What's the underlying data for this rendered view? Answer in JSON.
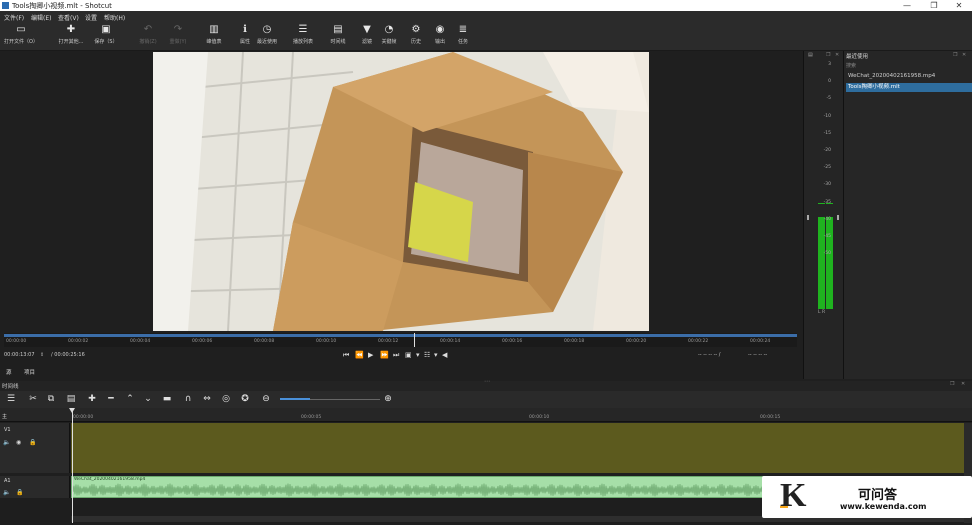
{
  "window": {
    "title": "Tools掏卿小视频.mlt - Shotcut",
    "controls": [
      "—",
      "❐",
      "✕"
    ]
  },
  "menu": [
    "文件(F)",
    "编辑(E)",
    "查看(V)",
    "设置",
    "帮助(H)"
  ],
  "toolbar": [
    {
      "label": "打开文件（O）",
      "icon": "open-file-icon",
      "glyph": "▭",
      "enabled": true
    },
    {
      "label": "打开其他...",
      "icon": "open-other-icon",
      "glyph": "✚",
      "enabled": true
    },
    {
      "label": "保存（S）",
      "icon": "save-icon",
      "glyph": "▣",
      "enabled": true
    },
    {
      "label": "撤销(Z)",
      "icon": "undo-icon",
      "glyph": "↶",
      "enabled": false
    },
    {
      "label": "重做(Y)",
      "icon": "redo-icon",
      "glyph": "↷",
      "enabled": false
    },
    {
      "label": "峰值表",
      "icon": "peak-meter-icon",
      "glyph": "▥",
      "enabled": true
    },
    {
      "label": "属性",
      "icon": "properties-icon",
      "glyph": "ℹ",
      "enabled": true
    },
    {
      "label": "最近使用",
      "icon": "recent-icon",
      "glyph": "◷",
      "enabled": true
    },
    {
      "label": "播放列表",
      "icon": "playlist-icon",
      "glyph": "☰",
      "enabled": true
    },
    {
      "label": "时间线",
      "icon": "timeline-icon",
      "glyph": "▤",
      "enabled": true
    },
    {
      "label": "滤镜",
      "icon": "filter-icon",
      "glyph": "▼",
      "enabled": true
    },
    {
      "label": "关键帧",
      "icon": "keyframe-icon",
      "glyph": "◔",
      "enabled": true
    },
    {
      "label": "历史",
      "icon": "history-icon",
      "glyph": "⚙",
      "enabled": true
    },
    {
      "label": "输出",
      "icon": "export-icon",
      "glyph": "◉",
      "enabled": true
    },
    {
      "label": "任务",
      "icon": "jobs-icon",
      "glyph": "≣",
      "enabled": true
    }
  ],
  "player": {
    "ruler_labels": [
      "00:00:00",
      "00:00:02",
      "00:00:04",
      "00:00:06",
      "00:00:08",
      "00:00:10",
      "00:00:12",
      "00:00:14",
      "00:00:16",
      "00:00:18",
      "00:00:20",
      "00:00:22",
      "00:00:24"
    ],
    "position": "00:00:13:07",
    "duration": "/ 00:00:25:16",
    "in_point": "-- -- -- -- /",
    "out_point": "-- -- -- --",
    "tabs": [
      "源",
      "项目"
    ]
  },
  "meter": {
    "labels": [
      "3",
      "0",
      "-5",
      "-10",
      "-15",
      "-20",
      "-25",
      "-30",
      "-35",
      "-40",
      "-45",
      "-50"
    ],
    "channels": "L  R",
    "level_db": -24
  },
  "recent": {
    "header": "最近使用",
    "search_placeholder": "搜索",
    "items": [
      "WeChat_20200402161958.mp4",
      "Tools掏卿小视频.mlt"
    ],
    "selected_index": 1
  },
  "timeline": {
    "title": "时间线",
    "ruler_labels": [
      "00:00:00",
      "00:00:05",
      "00:00:10",
      "00:00:15"
    ],
    "master_label": "主",
    "tracks": [
      {
        "name": "V1"
      },
      {
        "name": "A1",
        "clip": "WeChat_20200402161958.mp4"
      }
    ],
    "zoom_level": 0.3
  },
  "watermark": {
    "logo_letter": "K",
    "name": "可问答",
    "url": "www.kewenda.com"
  },
  "colors": {
    "accent": "#3b6da8",
    "video_track": "#5c5a1e",
    "audio_clip": "#a6dfa8",
    "meter_green": "#1fb31f"
  }
}
